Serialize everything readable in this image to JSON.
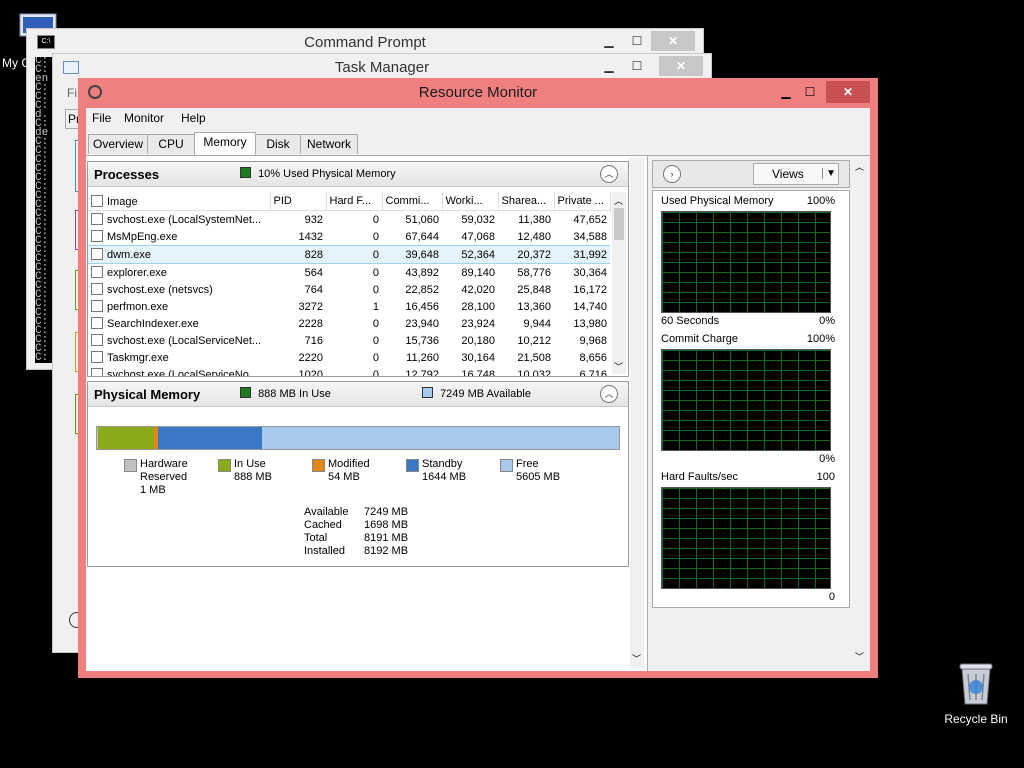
{
  "desktop": {
    "my_computer_label": "My C",
    "recycle_bin_label": "Recycle Bin"
  },
  "command_prompt": {
    "title": "Command Prompt",
    "min": "▁",
    "max": "☐",
    "close": "✕",
    "console_lines": [
      "C:",
      "C:",
      "en",
      "C:",
      "C:",
      "C:",
      "d.",
      "C:",
      "de",
      "C:",
      "C:",
      "C:",
      "C:",
      "C:",
      "C:",
      "C:",
      "C:",
      "C:",
      "C:",
      "C:",
      "C:",
      "C:",
      "C:",
      "C:",
      "C:",
      "C:",
      "C:",
      "C:",
      "C:",
      "C:",
      "C:",
      "C:",
      "C:",
      "C:"
    ]
  },
  "task_manager": {
    "title": "Task Manager",
    "min": "▁",
    "max": "☐",
    "close": "✕",
    "menu_fragment": "Fi",
    "tab_fragment": "Pr"
  },
  "resource_monitor": {
    "title": "Resource Monitor",
    "controls": {
      "min": "▁",
      "max": "☐",
      "close": "✕"
    },
    "menu": [
      "File",
      "Monitor",
      "Help"
    ],
    "tabs": [
      "Overview",
      "CPU",
      "Memory",
      "Disk",
      "Network"
    ],
    "active_tab": "Memory",
    "processes": {
      "title": "Processes",
      "status": "10% Used Physical Memory",
      "status_color": "#1e7a1e",
      "columns": [
        "Image",
        "PID",
        "Hard F...",
        "Commi...",
        "Worki...",
        "Sharea...",
        "Private ..."
      ],
      "rows": [
        [
          "svchost.exe (LocalSystemNet...",
          "932",
          "0",
          "51,060",
          "59,032",
          "11,380",
          "47,652"
        ],
        [
          "MsMpEng.exe",
          "1432",
          "0",
          "67,644",
          "47,068",
          "12,480",
          "34,588"
        ],
        [
          "dwm.exe",
          "828",
          "0",
          "39,648",
          "52,364",
          "20,372",
          "31,992"
        ],
        [
          "explorer.exe",
          "564",
          "0",
          "43,892",
          "89,140",
          "58,776",
          "30,364"
        ],
        [
          "svchost.exe (netsvcs)",
          "764",
          "0",
          "22,852",
          "42,020",
          "25,848",
          "16,172"
        ],
        [
          "perfmon.exe",
          "3272",
          "1",
          "16,456",
          "28,100",
          "13,360",
          "14,740"
        ],
        [
          "SearchIndexer.exe",
          "2228",
          "0",
          "23,940",
          "23,924",
          "9,944",
          "13,980"
        ],
        [
          "svchost.exe (LocalServiceNet...",
          "716",
          "0",
          "15,736",
          "20,180",
          "10,212",
          "9,968"
        ],
        [
          "Taskmgr.exe",
          "2220",
          "0",
          "11,260",
          "30,164",
          "21,508",
          "8,656"
        ],
        [
          "svchost.exe (LocalServiceNo...",
          "1020",
          "0",
          "12,792",
          "16,748",
          "10,032",
          "6,716"
        ]
      ],
      "selected_row": 2
    },
    "physical_memory": {
      "title": "Physical Memory",
      "in_use_text": "888 MB In Use",
      "available_text": "7249 MB Available",
      "bar": {
        "hardware_reserved_mb": 1,
        "in_use_mb": 888,
        "modified_mb": 54,
        "standby_mb": 1644,
        "free_mb": 5605
      },
      "colors": {
        "hardware_reserved": "#c0c0c0",
        "in_use": "#8aaa1a",
        "modified": "#e0861a",
        "standby": "#3a78c4",
        "free": "#a8c8ec"
      },
      "legend": [
        {
          "name": "Hardware Reserved",
          "line1": "Hardware",
          "line2": "Reserved",
          "value": "1 MB"
        },
        {
          "name": "In Use",
          "line1": "In Use",
          "line2": "",
          "value": "888 MB"
        },
        {
          "name": "Modified",
          "line1": "Modified",
          "line2": "",
          "value": "54 MB"
        },
        {
          "name": "Standby",
          "line1": "Standby",
          "line2": "",
          "value": "1644 MB"
        },
        {
          "name": "Free",
          "line1": "Free",
          "line2": "",
          "value": "5605 MB"
        }
      ],
      "stats": [
        {
          "label": "Available",
          "value": "7249 MB"
        },
        {
          "label": "Cached",
          "value": "1698 MB"
        },
        {
          "label": "Total",
          "value": "8191 MB"
        },
        {
          "label": "Installed",
          "value": "8192 MB"
        }
      ]
    },
    "side": {
      "views_label": "Views",
      "graphs": [
        {
          "title": "Used Physical Memory",
          "max": "100%",
          "footer_left": "60 Seconds",
          "footer_right": "0%"
        },
        {
          "title": "Commit Charge",
          "max": "100%",
          "footer_left": "",
          "footer_right": "0%"
        },
        {
          "title": "Hard Faults/sec",
          "max": "100",
          "footer_left": "",
          "footer_right": "0"
        }
      ]
    }
  }
}
